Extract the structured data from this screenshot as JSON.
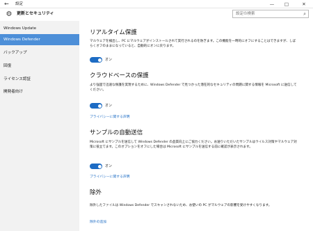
{
  "window": {
    "title": "設定",
    "back_glyph": "←",
    "minimize_glyph": "—",
    "maximize_glyph": "□",
    "close_glyph": "✕"
  },
  "header": {
    "title": "更新とセキュリティ",
    "icon": "gear-icon",
    "search_placeholder": "設定の検索",
    "search_icon": "search-icon"
  },
  "sidebar": {
    "items": [
      {
        "label": "Windows Update",
        "selected": false
      },
      {
        "label": "Windows Defender",
        "selected": true
      },
      {
        "label": "バックアップ",
        "selected": false
      },
      {
        "label": "回復",
        "selected": false
      },
      {
        "label": "ライセンス認証",
        "selected": false
      },
      {
        "label": "開発者向け",
        "selected": false
      }
    ]
  },
  "sections": {
    "realtime": {
      "title": "リアルタイム保護",
      "desc": "マルウェアを検出し、PC にマルウェアがインストールされて実行されるのを防ぎます。この機能を一時的にオフにすることはできますが、しばらくオフのままになっていると、自動的にオンに戻ります。",
      "toggle_label": "オン",
      "toggle_on": true
    },
    "cloud": {
      "title": "クラウドベースの保護",
      "desc": "より強固で迅速な保護を実現するために、Windows Defender で見つかった潜在的なセキュリティの問題に関する情報を Microsoft に送信してください。",
      "toggle_label": "オン",
      "toggle_on": true,
      "link": "プライバシーに関する声明"
    },
    "sample": {
      "title": "サンプルの自動送信",
      "desc": "Microsoft にサンプルを送信して Windows Defender の品質向上にご協力ください。お送りいただいたサンプルはウイルス対策やマルウェア対策に役立てます。このオプションをオフにした場合は Microsoft にサンプルを送信する前に確認が表示されます。",
      "toggle_label": "オン",
      "toggle_on": true,
      "link": "プライバシーに関する声明"
    },
    "exclusion": {
      "title": "除外",
      "desc": "除外したファイルは Windows Defender でスキャンされないため、お使いの PC がマルウェアの影響を受けやすくなります。",
      "link": "除外の追加"
    }
  },
  "colors": {
    "accent": "#1d6cc4",
    "selected_nav": "#4d8fd8",
    "sidebar_bg": "#f2f2f2"
  }
}
